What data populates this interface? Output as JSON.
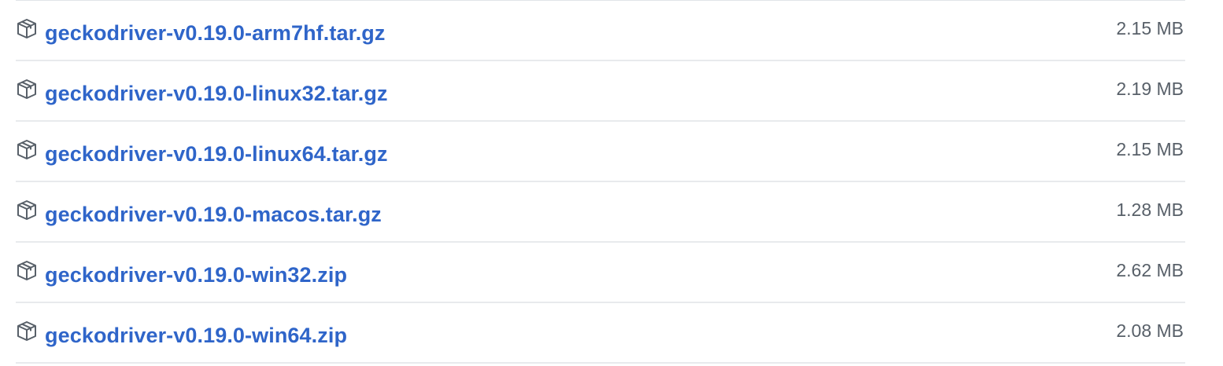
{
  "colors": {
    "link": "#2f65c9",
    "size_text": "#586069",
    "divider": "#e8eaed",
    "icon": "#586069"
  },
  "assets": [
    {
      "icon": "package-icon",
      "name": "geckodriver-v0.19.0-arm7hf.tar.gz",
      "size": "2.15 MB"
    },
    {
      "icon": "package-icon",
      "name": "geckodriver-v0.19.0-linux32.tar.gz",
      "size": "2.19 MB"
    },
    {
      "icon": "package-icon",
      "name": "geckodriver-v0.19.0-linux64.tar.gz",
      "size": "2.15 MB"
    },
    {
      "icon": "package-icon",
      "name": "geckodriver-v0.19.0-macos.tar.gz",
      "size": "1.28 MB"
    },
    {
      "icon": "package-icon",
      "name": "geckodriver-v0.19.0-win32.zip",
      "size": "2.62 MB"
    },
    {
      "icon": "package-icon",
      "name": "geckodriver-v0.19.0-win64.zip",
      "size": "2.08 MB"
    }
  ]
}
